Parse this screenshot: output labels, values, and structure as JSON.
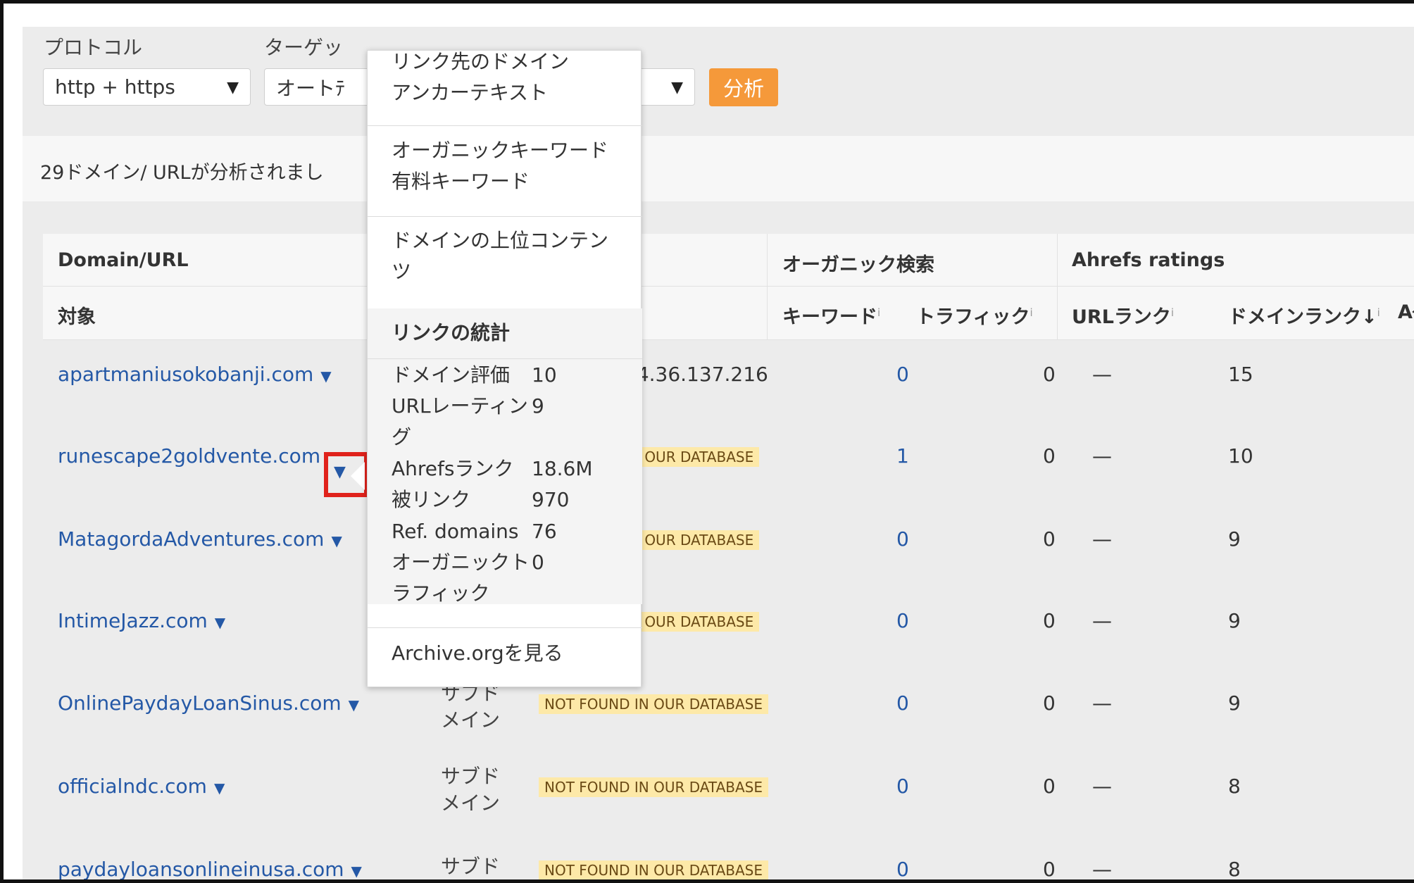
{
  "controls": {
    "protocol_label": "プロトコル",
    "protocol_value": "http + https",
    "target_label": "ターゲッ",
    "target_value": "オートﾃ",
    "analyze_label": "分析"
  },
  "summary": "29ドメイン/ URLが分析されまし",
  "table": {
    "group_headers": {
      "domain": "Domain/URL",
      "organic": "オーガニック検索",
      "ratings": "Ahrefs ratings"
    },
    "col_headers": {
      "target": "対象",
      "keywords": "キーワード",
      "traffic": "トラフィック",
      "url_rank": "URLランク",
      "domain_rank": "ドメインランク↓",
      "cut": "Ał",
      "info": "i"
    },
    "rows": [
      {
        "domain": "apartmaniusokobanji.com",
        "type": "",
        "status": "",
        "ip": "54.36.137.216",
        "keywords": "0",
        "traffic": "0",
        "url_rank": "—",
        "domain_rank": "15"
      },
      {
        "domain": "runescape2goldvente.com",
        "type": "",
        "status": "N OUR DATABASE",
        "ip": "",
        "keywords": "1",
        "traffic": "0",
        "url_rank": "—",
        "domain_rank": "10"
      },
      {
        "domain": "MatagordaAdventures.com",
        "type": "",
        "status": "N OUR DATABASE",
        "ip": "",
        "keywords": "0",
        "traffic": "0",
        "url_rank": "—",
        "domain_rank": "9"
      },
      {
        "domain": "IntimeJazz.com",
        "type": "",
        "status": "N OUR DATABASE",
        "ip": "",
        "keywords": "0",
        "traffic": "0",
        "url_rank": "—",
        "domain_rank": "9"
      },
      {
        "domain": "OnlinePaydayLoanSinus.com",
        "type": "サブド\nメイン",
        "status": "NOT FOUND IN OUR DATABASE",
        "ip": "",
        "keywords": "0",
        "traffic": "0",
        "url_rank": "—",
        "domain_rank": "9"
      },
      {
        "domain": "officialndc.com",
        "type": "サブド\nメイン",
        "status": "NOT FOUND IN OUR DATABASE",
        "ip": "",
        "keywords": "0",
        "traffic": "0",
        "url_rank": "—",
        "domain_rank": "8"
      },
      {
        "domain": "paydayloansonlineinusa.com",
        "type": "サブド",
        "status": "NOT FOUND IN OUR DATABASE",
        "ip": "",
        "keywords": "0",
        "traffic": "0",
        "url_rank": "—",
        "domain_rank": "8"
      }
    ]
  },
  "menu": {
    "group1": [
      "リンク先のドメイン",
      "アンカーテキスト"
    ],
    "group2": [
      "オーガニックキーワード",
      "有料キーワード"
    ],
    "group3": [
      "ドメインの上位コンテン",
      "ツ"
    ],
    "stats_title": "リンクの統計",
    "stats": [
      {
        "label": "ドメイン評価",
        "value": "10"
      },
      {
        "label": "URLレーティン\nグ",
        "value": "9"
      },
      {
        "label": "Ahrefsランク",
        "value": "18.6M"
      },
      {
        "label": "被リンク",
        "value": "970"
      },
      {
        "label": "Ref. domains",
        "value": "76"
      },
      {
        "label": "オーガニックト\nラフィック",
        "value": "0"
      }
    ],
    "archive": "Archive.orgを見る"
  },
  "caret": "▼"
}
